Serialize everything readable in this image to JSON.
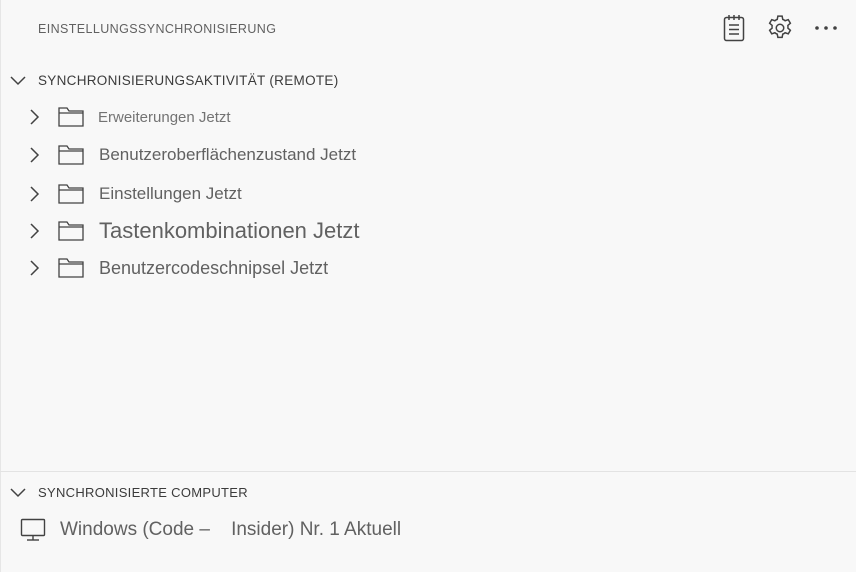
{
  "panel": {
    "title": "EINSTELLUNGSSYNCHRONISIERUNG",
    "toolbar_icons": [
      "notes-icon",
      "gear-icon",
      "more-icon"
    ]
  },
  "activity_section": {
    "title": "SYNCHRONISIERUNGSAKTIVITÄT (REMOTE)",
    "items": [
      {
        "label": "Erweiterungen Jetzt"
      },
      {
        "label": "Benutzeroberflächenzustand Jetzt"
      },
      {
        "label": "Einstellungen Jetzt"
      },
      {
        "label": "Tastenkombinationen Jetzt"
      },
      {
        "label": "Benutzercodeschnipsel Jetzt"
      }
    ]
  },
  "machines_section": {
    "title": "SYNCHRONISIERTE COMPUTER",
    "items": [
      {
        "label": "Windows (Code –    Insider) Nr. 1 Aktuell"
      }
    ]
  }
}
